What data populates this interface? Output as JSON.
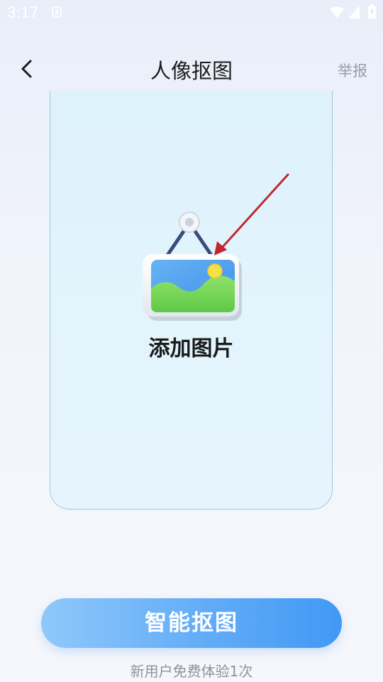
{
  "status_bar": {
    "time": "3:17",
    "icons": [
      "notification-a-icon",
      "wifi-icon",
      "signal-icon",
      "battery-icon"
    ]
  },
  "header": {
    "title": "人像抠图",
    "report_label": "举报",
    "back_icon": "chevron-left-icon"
  },
  "upload": {
    "label": "添加图片",
    "icon": "hanging-picture-icon"
  },
  "actions": {
    "primary_label": "智能抠图",
    "trial_note": "新用户免费体验1次"
  },
  "colors": {
    "accent": "#4198f5",
    "card_bg": "#e3f4fc",
    "annotation_arrow": "#c0282d"
  }
}
